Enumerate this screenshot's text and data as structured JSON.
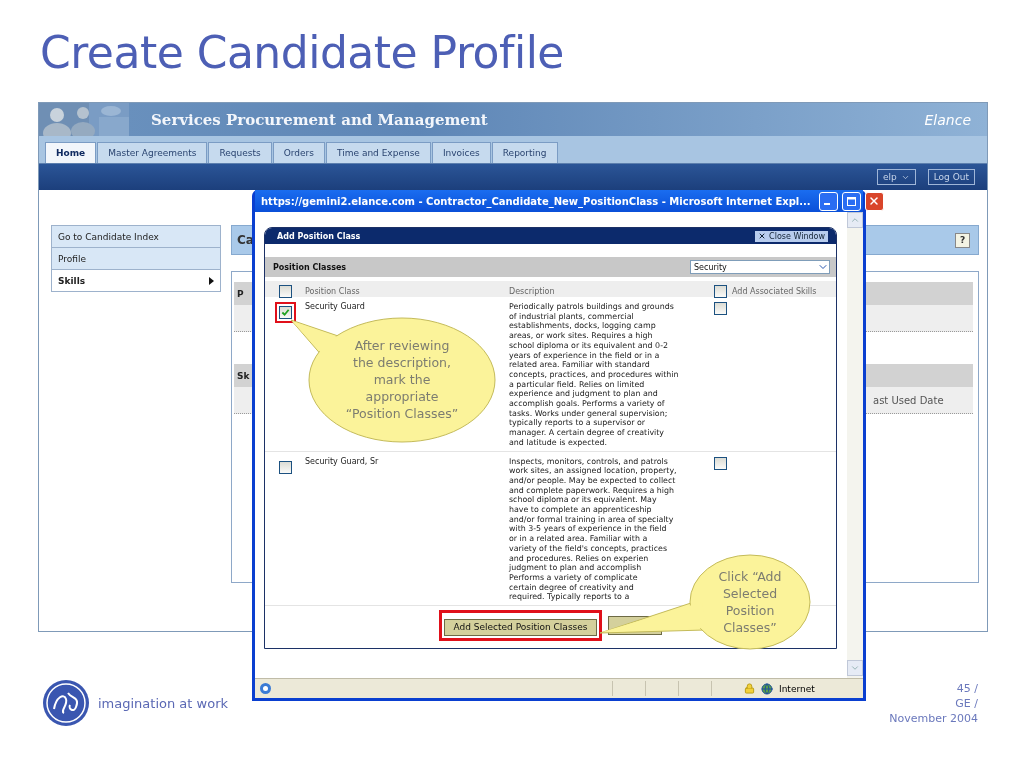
{
  "slide": {
    "title": "Create Candidate Profile",
    "tagline": "imagination at work",
    "footer_lines": [
      "45 /",
      "GE /",
      "November 2004"
    ]
  },
  "app": {
    "title": "Services Procurement and Management",
    "brand": "Elance",
    "tabs": [
      {
        "label": "Home",
        "selected": true
      },
      {
        "label": "Master Agreements",
        "selected": false
      },
      {
        "label": "Requests",
        "selected": false
      },
      {
        "label": "Orders",
        "selected": false
      },
      {
        "label": "Time and Expense",
        "selected": false
      },
      {
        "label": "Invoices",
        "selected": false
      },
      {
        "label": "Reporting",
        "selected": false
      }
    ],
    "user_menu": "elp",
    "logout": "Log Out",
    "nav": [
      {
        "label": "Go to Candidate Index",
        "selected": false
      },
      {
        "label": "Profile",
        "selected": false
      },
      {
        "label": "Skills",
        "selected": true
      }
    ],
    "heading": "Ca",
    "help": "?",
    "sections": [
      {
        "title": "P"
      },
      {
        "title": "Sk",
        "column": "ast Used Date"
      }
    ]
  },
  "browser": {
    "title": "https://gemini2.elance.com - Contractor_Candidate_New_PositionClass - Microsoft Internet Expl...",
    "zone": "Internet"
  },
  "dialog": {
    "title": "Add Position Class",
    "close": "Close Window",
    "section": "Position Classes",
    "filter": "Security",
    "columns": [
      "Position Class",
      "Description",
      "Add Associated Skills"
    ],
    "select_all": false,
    "skills_all": false,
    "rows": [
      {
        "name": "Security Guard",
        "checked": true,
        "highlighted": true,
        "add_skills": false,
        "description": "Periodically patrols buildings and grounds\nof industrial plants, commercial\nestablishments, docks, logging camp\nareas, or work sites. Requires a high\nschool diploma or its equivalent and 0-2\nyears of experience in the field or in a\nrelated area. Familiar with standard\nconcepts, practices, and procedures within\na particular field. Relies on limited\nexperience and judgment to plan and\naccomplish goals. Performs a variety of\ntasks. Works under general supervision;\ntypically reports to a supervisor or\nmanager. A certain degree of creativity\nand latitude is expected."
      },
      {
        "name": "Security Guard, Sr",
        "checked": false,
        "highlighted": false,
        "add_skills": false,
        "description": "Inspects, monitors, controls, and patrols\nwork sites, an assigned location, property,\nand/or people. May be expected to collect\nand complete paperwork. Requires a high\nschool diploma or its equivalent. May\nhave to complete an apprenticeship\nand/or formal training in area of specialty\nwith 3-5 years of experience in the field\nor in a related area. Familiar with a\nvariety of the field's concepts, practices\nand procedures. Relies on experien\njudgment to plan and accomplish\nPerforms a variety of complicate\ncertain degree of creativity and\nrequired. Typically reports to a"
      }
    ],
    "button": {
      "label": "Add Selected Position Classes",
      "highlighted": true
    }
  },
  "callouts": [
    "After reviewing\nthe description,\nmark the\nappropriate\n“Position Classes”",
    "Click “Add\nSelected\nPosition\nClasses”"
  ]
}
